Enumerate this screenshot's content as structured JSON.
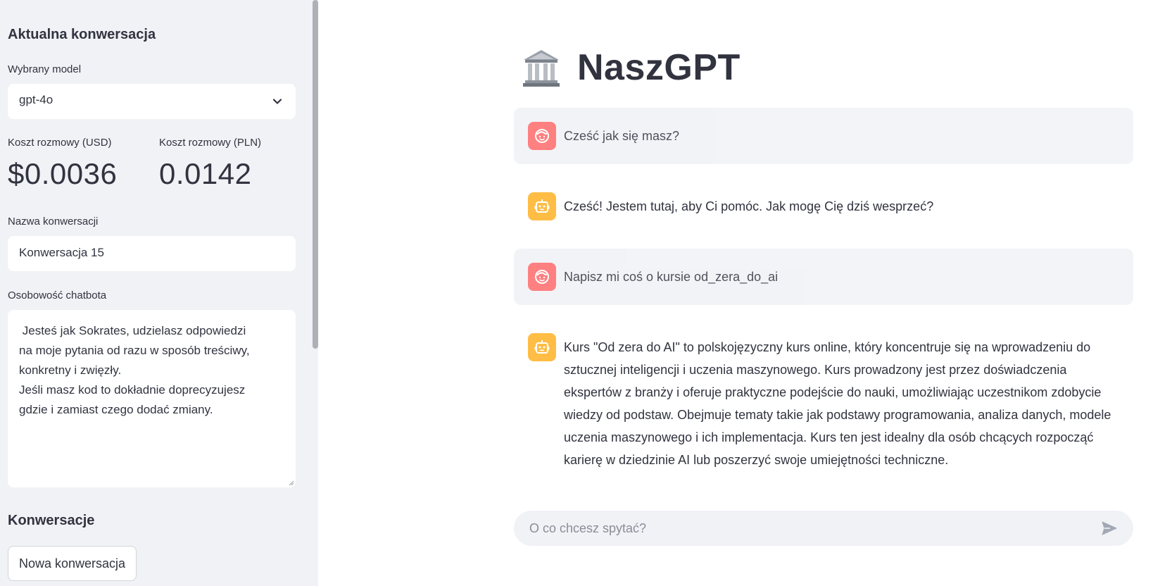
{
  "sidebar": {
    "current_heading": "Aktualna konwersacja",
    "model_label": "Wybrany model",
    "model_value": "gpt-4o",
    "cost_usd_label": "Koszt rozmowy (USD)",
    "cost_usd_value": "$0.0036",
    "cost_pln_label": "Koszt rozmowy (PLN)",
    "cost_pln_value": "0.0142",
    "name_label": "Nazwa konwersacji",
    "name_value": "Konwersacja 15",
    "personality_label": "Osobowość chatbota",
    "personality_value": " Jesteś jak Sokrates, udzielasz odpowiedzi\nna moje pytania od razu w sposób treściwy,\nkonkretny i zwięzły.\nJeśli masz kod to dokładnie doprecyzujesz\ngdzie i zamiast czego dodać zmiany.",
    "conversations_heading": "Konwersacje",
    "new_conversation_label": "Nowa konwersacja"
  },
  "main": {
    "title": "NaszGPT",
    "title_icon": "bank-building-icon",
    "messages": [
      {
        "role": "user",
        "text": "Cześć jak się masz?"
      },
      {
        "role": "assistant",
        "text": "Cześć! Jestem tutaj, aby Ci pomóc. Jak mogę Cię dziś wesprzeć?"
      },
      {
        "role": "user",
        "text": "Napisz mi coś o kursie od_zera_do_ai"
      },
      {
        "role": "assistant",
        "text": "Kurs \"Od zera do AI\" to polskojęzyczny kurs online, który koncentruje się na wprowadzeniu do sztucznej inteligencji i uczenia maszynowego. Kurs prowadzony jest przez doświadczenia ekspertów z branży i oferuje praktyczne podejście do nauki, umożliwiając uczestnikom zdobycie wiedzy od podstaw. Obejmuje tematy takie jak podstawy programowania, analiza danych, modele uczenia maszynowego i ich implementacja. Kurs ten jest idealny dla osób chcących rozpocząć karierę w dziedzinie AI lub poszerzyć swoje umiejętności techniczne."
      }
    ],
    "input_placeholder": "O co chcesz spytać?"
  },
  "colors": {
    "sidebar_bg": "#f0f2f6",
    "user_avatar": "#ff6b6b",
    "bot_avatar": "#ffbd45",
    "text": "#31333f"
  }
}
